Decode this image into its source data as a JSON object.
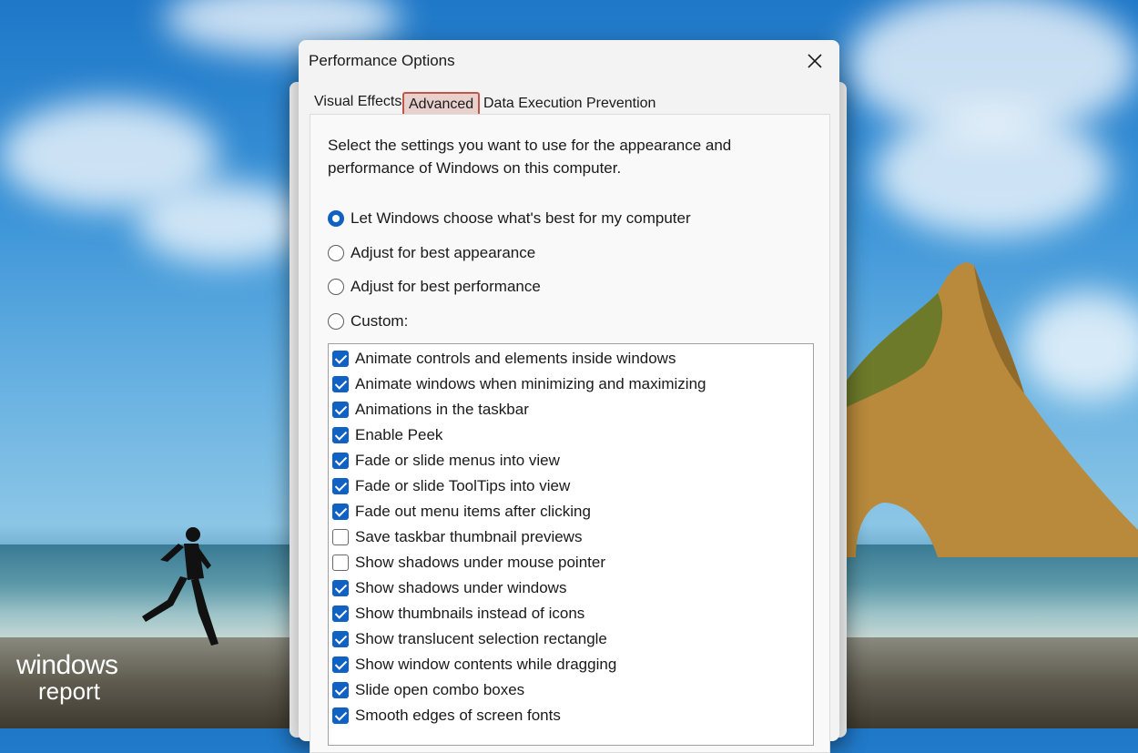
{
  "window": {
    "title": "Performance Options",
    "close_label": "×"
  },
  "tabs": [
    {
      "label": "Visual Effects",
      "selected": false
    },
    {
      "label": "Advanced",
      "selected": true,
      "highlighted": true
    },
    {
      "label": "Data Execution Prevention",
      "selected": false
    }
  ],
  "panel": {
    "description": "Select the settings you want to use for the appearance and performance of Windows on this computer.",
    "radios": [
      {
        "label": "Let Windows choose what's best for my computer",
        "checked": true
      },
      {
        "label": "Adjust for best appearance",
        "checked": false
      },
      {
        "label": "Adjust for best performance",
        "checked": false
      },
      {
        "label": "Custom:",
        "checked": false
      }
    ],
    "effects": [
      {
        "label": "Animate controls and elements inside windows",
        "checked": true
      },
      {
        "label": "Animate windows when minimizing and maximizing",
        "checked": true
      },
      {
        "label": "Animations in the taskbar",
        "checked": true
      },
      {
        "label": "Enable Peek",
        "checked": true
      },
      {
        "label": "Fade or slide menus into view",
        "checked": true
      },
      {
        "label": "Fade or slide ToolTips into view",
        "checked": true
      },
      {
        "label": "Fade out menu items after clicking",
        "checked": true
      },
      {
        "label": "Save taskbar thumbnail previews",
        "checked": false
      },
      {
        "label": "Show shadows under mouse pointer",
        "checked": false
      },
      {
        "label": "Show shadows under windows",
        "checked": true
      },
      {
        "label": "Show thumbnails instead of icons",
        "checked": true
      },
      {
        "label": "Show translucent selection rectangle",
        "checked": true
      },
      {
        "label": "Show window contents while dragging",
        "checked": true
      },
      {
        "label": "Slide open combo boxes",
        "checked": true
      },
      {
        "label": "Smooth edges of screen fonts",
        "checked": true
      }
    ]
  },
  "watermark": {
    "line1": "windows",
    "line2": "report"
  },
  "colors": {
    "accent": "#0f62c4",
    "tab_highlight": "#c1554a"
  }
}
